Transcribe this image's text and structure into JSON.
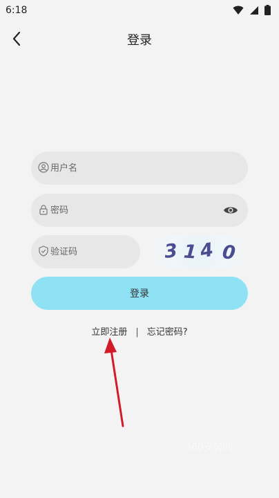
{
  "status_bar": {
    "time": "6:18",
    "icons": [
      "wifi-icon",
      "signal-icon",
      "battery-icon"
    ]
  },
  "header": {
    "back_icon": "chevron-left-icon",
    "title": "登录"
  },
  "form": {
    "username": {
      "placeholder": "用户名",
      "value": "",
      "icon": "user-icon"
    },
    "password": {
      "placeholder": "密码",
      "value": "",
      "icon": "lock-icon",
      "toggle_icon": "eye-icon"
    },
    "captcha": {
      "placeholder": "验证码",
      "value": "",
      "icon": "shield-icon",
      "image_text": [
        "3",
        "1",
        "4",
        "0"
      ]
    },
    "login_label": "登录"
  },
  "links": {
    "register": "立即注册",
    "separator": "|",
    "forgot": "忘记密码?"
  },
  "watermark": "360安装网",
  "colors": {
    "background": "#f3f3f3",
    "field_bg": "#e7e7e7",
    "login_button": "#8fe2f4",
    "captcha_text": "#4a4d8f",
    "arrow": "#d21b2a"
  }
}
